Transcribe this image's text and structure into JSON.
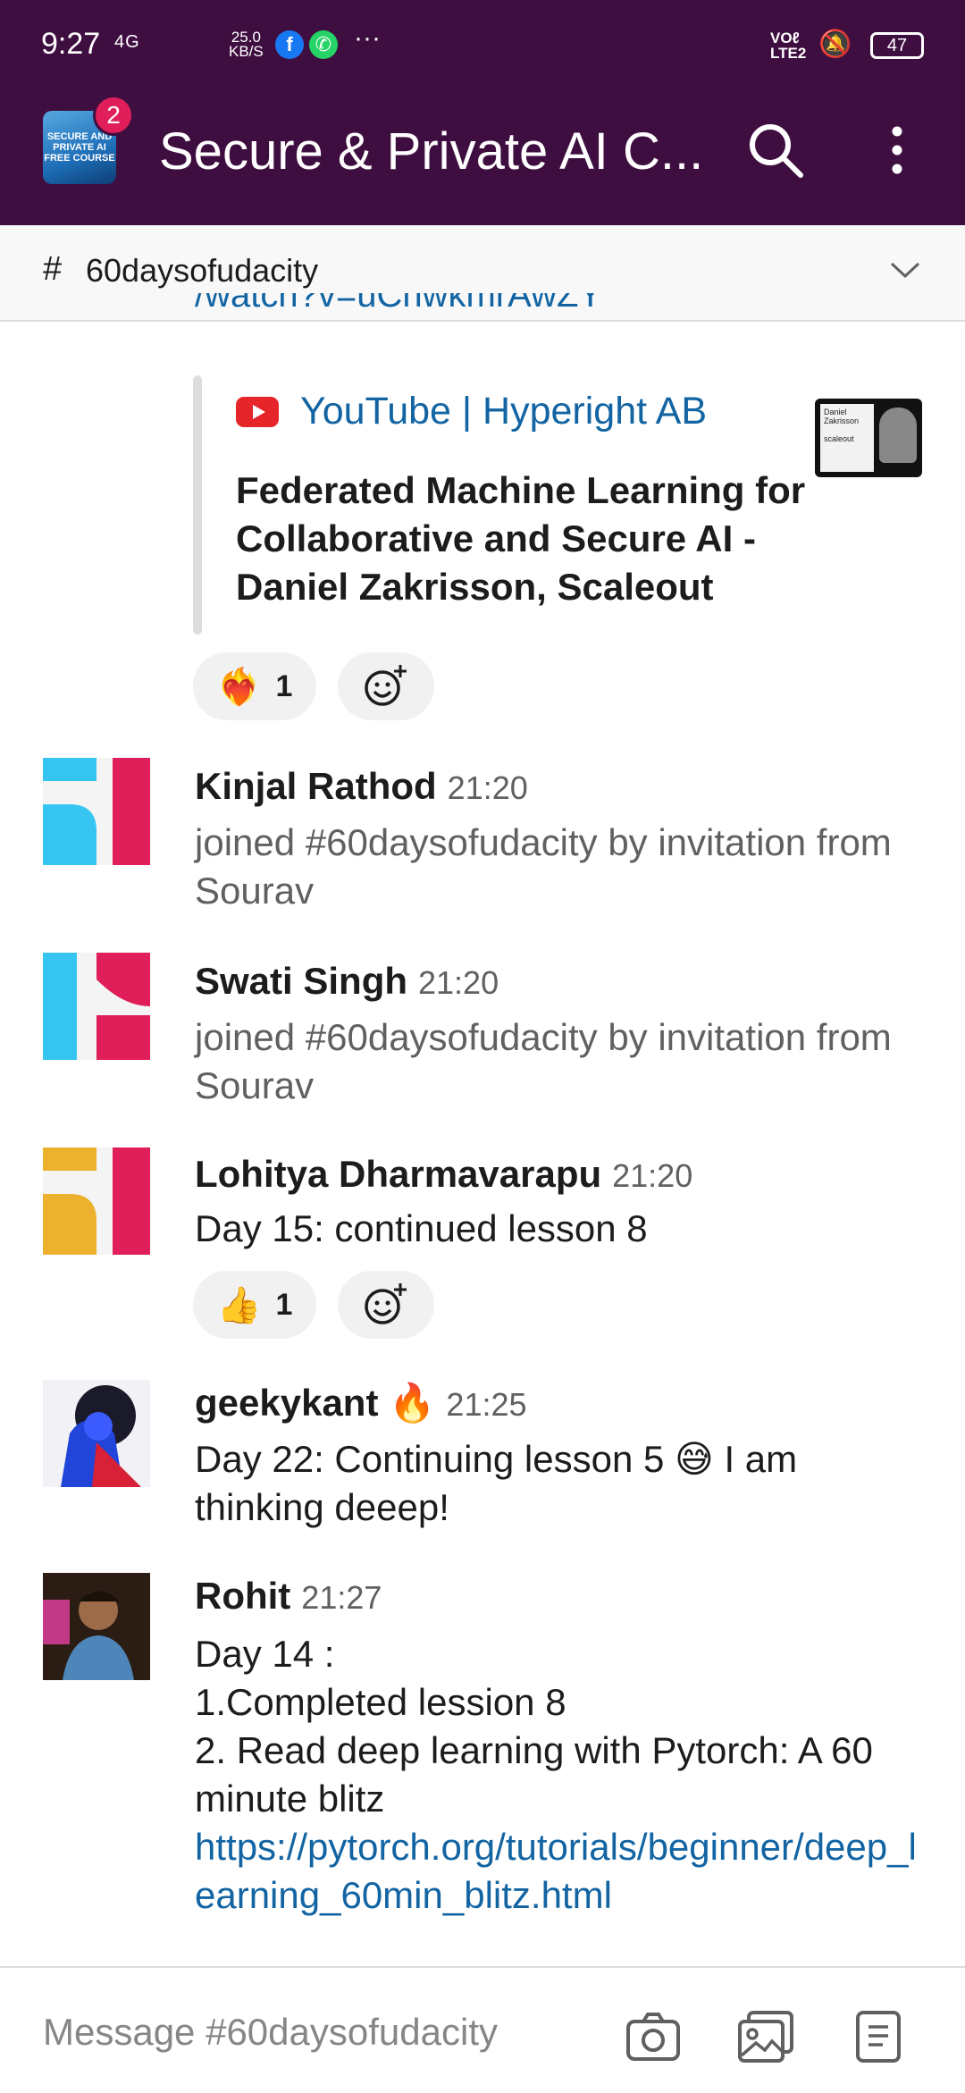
{
  "status_bar": {
    "time": "9:27",
    "network": "4G",
    "speed_value": "25.0",
    "speed_unit": "KB/S",
    "more": "···",
    "volte_top": "VOℓ",
    "volte_bottom": "LTE2",
    "battery": "47"
  },
  "app_bar": {
    "workspace_logo_text": "SECURE AND PRIVATE AI FREE COURSE",
    "badge_count": "2",
    "title": "Secure & Private AI C..."
  },
  "channel_bar": {
    "hash": "#",
    "channel_name": "60daysofudacity"
  },
  "messages": {
    "cut_link": "/watch?v=uChwkmrAwZY",
    "attachment": {
      "source": "YouTube | Hyperight AB",
      "title": "Federated Machine Learning for Collaborative and Secure AI - Daniel Zakrisson, Scaleout",
      "thumb_name": "Daniel Zakrisson",
      "thumb_brand": "scaleout"
    },
    "reaction1": {
      "emoji": "❤️‍🔥",
      "count": "1"
    },
    "items": [
      {
        "sender": "Kinjal Rathod",
        "time": "21:20",
        "text": "joined #60daysofudacity by invitation from Sourav"
      },
      {
        "sender": "Swati Singh",
        "time": "21:20",
        "text": "joined #60daysofudacity by invitation from Sourav"
      },
      {
        "sender": "Lohitya Dharmavarapu",
        "time": "21:20",
        "text": "Day 15: continued lesson 8"
      },
      {
        "sender": "geekykant",
        "sender_emoji": "🔥",
        "time": "21:25",
        "text": "Day 22: Continuing lesson 5 😅 I am thinking deeep!"
      },
      {
        "sender": "Rohit",
        "time": "21:27",
        "lines": [
          "Day 14 :",
          "1.Completed lession 8",
          "2. Read deep learning with Pytorch: A 60 minute blitz"
        ],
        "link": "https://pytorch.org/tutorials/beginner/deep_learning_60min_blitz.html"
      }
    ],
    "reaction2": {
      "emoji": "👍",
      "count": "1"
    }
  },
  "composer": {
    "placeholder": "Message #60daysofudacity"
  },
  "colors": {
    "aubergine": "#3f0e40",
    "link": "#1264a3",
    "badge": "#e01e5a",
    "slack_blue": "#36c5f0",
    "slack_red": "#e01e5a",
    "slack_yellow": "#ecb22e"
  }
}
